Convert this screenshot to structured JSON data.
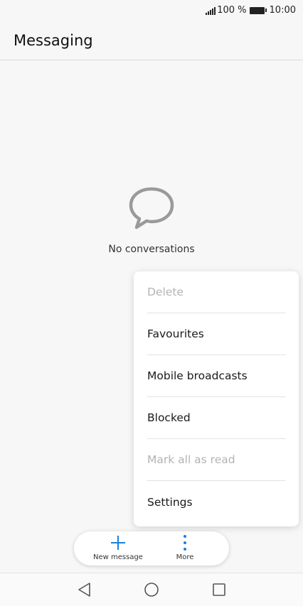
{
  "status_bar": {
    "battery_text": "100 %",
    "time": "10:00"
  },
  "app_bar": {
    "title": "Messaging"
  },
  "empty_state": {
    "icon": "chat-bubble-icon",
    "text": "No conversations"
  },
  "menu": {
    "items": [
      {
        "label": "Delete",
        "enabled": false
      },
      {
        "label": "Favourites",
        "enabled": true
      },
      {
        "label": "Mobile broadcasts",
        "enabled": true
      },
      {
        "label": "Blocked",
        "enabled": true
      },
      {
        "label": "Mark all as read",
        "enabled": false
      },
      {
        "label": "Settings",
        "enabled": true
      }
    ]
  },
  "toolbar": {
    "new_message_label": "New message",
    "more_label": "More",
    "accent_color": "#1a7fd9"
  },
  "nav": {
    "back_icon": "triangle-back-icon",
    "home_icon": "circle-home-icon",
    "recent_icon": "square-recent-icon"
  }
}
